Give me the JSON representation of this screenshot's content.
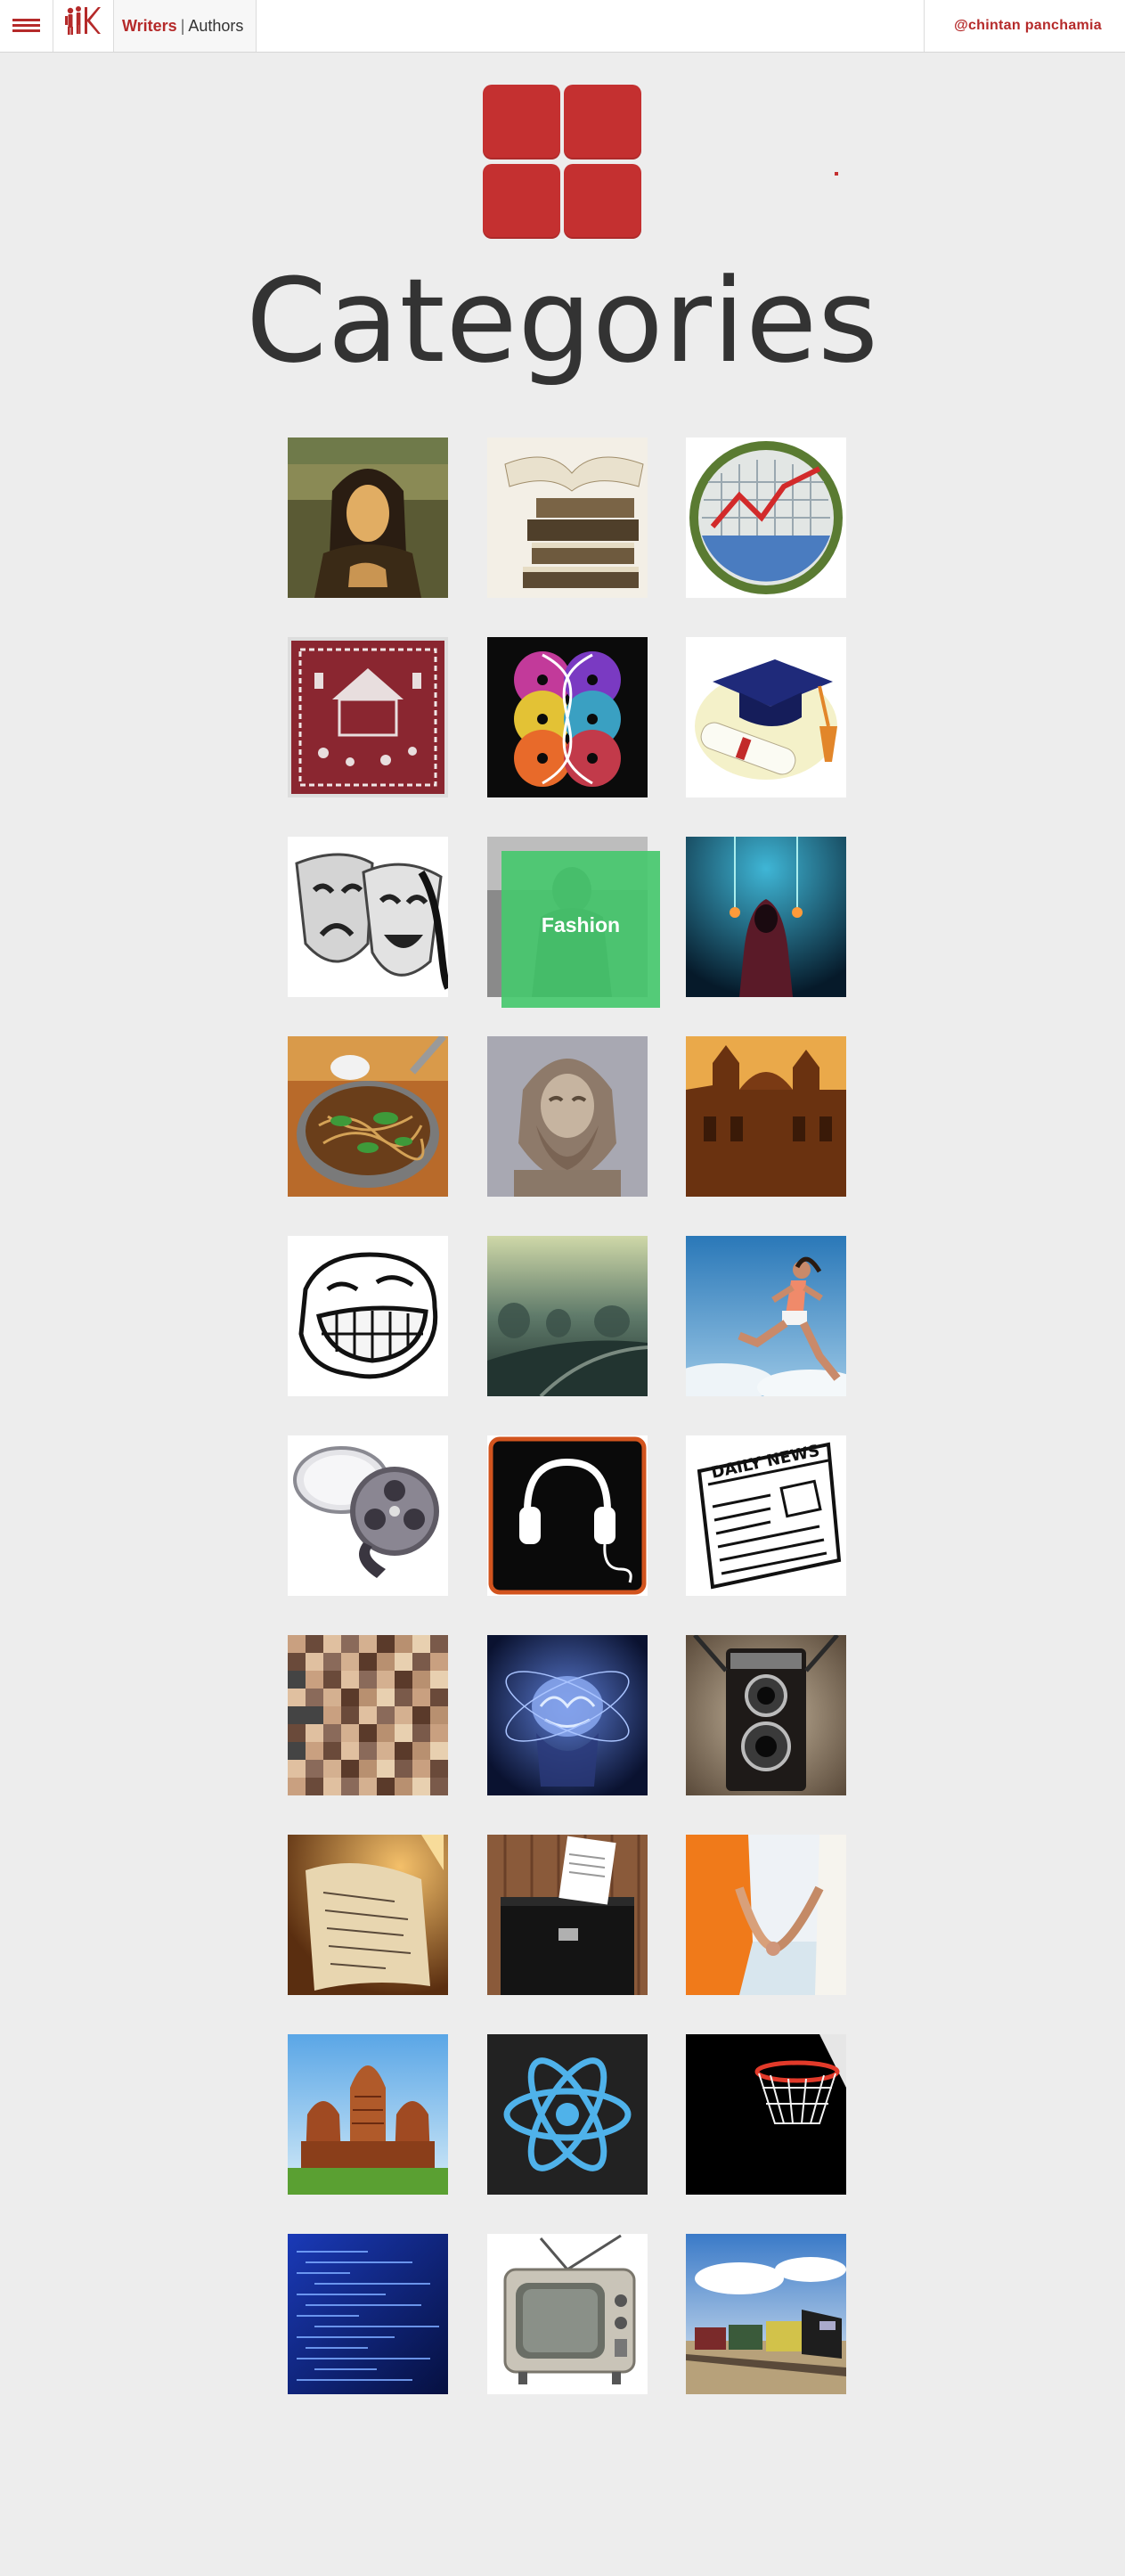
{
  "topbar": {
    "menu_icon": "hamburger-menu-icon",
    "logo_icon": "writers-logo-icon",
    "nav_active": "Writers",
    "nav_separator": "|",
    "nav_other": "Authors",
    "user_handle": "@chintan panchamia"
  },
  "hero": {
    "icon": "category-grid-icon",
    "title": "Categories"
  },
  "colors": {
    "accent": "#c43030",
    "hover_overlay": "#46c86e",
    "background": "#ededed"
  },
  "categories": [
    {
      "icon": "mona-lisa-painting-icon"
    },
    {
      "icon": "stack-of-books-icon"
    },
    {
      "icon": "economics-chart-badge-icon"
    },
    {
      "icon": "folk-art-embroidery-icon"
    },
    {
      "icon": "vinyl-records-music-icon"
    },
    {
      "icon": "graduation-cap-diploma-icon"
    },
    {
      "icon": "theatre-masks-icon"
    },
    {
      "icon": "fashion-icon",
      "label": "Fashion"
    },
    {
      "icon": "fantasy-hooded-figure-icon"
    },
    {
      "icon": "noodles-food-icon"
    },
    {
      "icon": "greek-god-bust-icon"
    },
    {
      "icon": "historic-architecture-icon"
    },
    {
      "icon": "troll-face-humor-icon"
    },
    {
      "icon": "misty-landscape-icon"
    },
    {
      "icon": "running-woman-fitness-icon"
    },
    {
      "icon": "film-reel-icon"
    },
    {
      "icon": "headphones-icon"
    },
    {
      "icon": "daily-news-newspaper-icon"
    },
    {
      "icon": "people-faces-collage-icon"
    },
    {
      "icon": "glowing-brain-icon"
    },
    {
      "icon": "vintage-camera-icon"
    },
    {
      "icon": "handwritten-letter-icon"
    },
    {
      "icon": "ballot-box-politics-icon"
    },
    {
      "icon": "holding-hands-relationships-icon"
    },
    {
      "icon": "indian-temple-icon"
    },
    {
      "icon": "react-atom-icon"
    },
    {
      "icon": "basketball-hoop-icon"
    },
    {
      "icon": "programming-code-icon"
    },
    {
      "icon": "retro-television-icon"
    },
    {
      "icon": "freight-train-icon"
    }
  ]
}
